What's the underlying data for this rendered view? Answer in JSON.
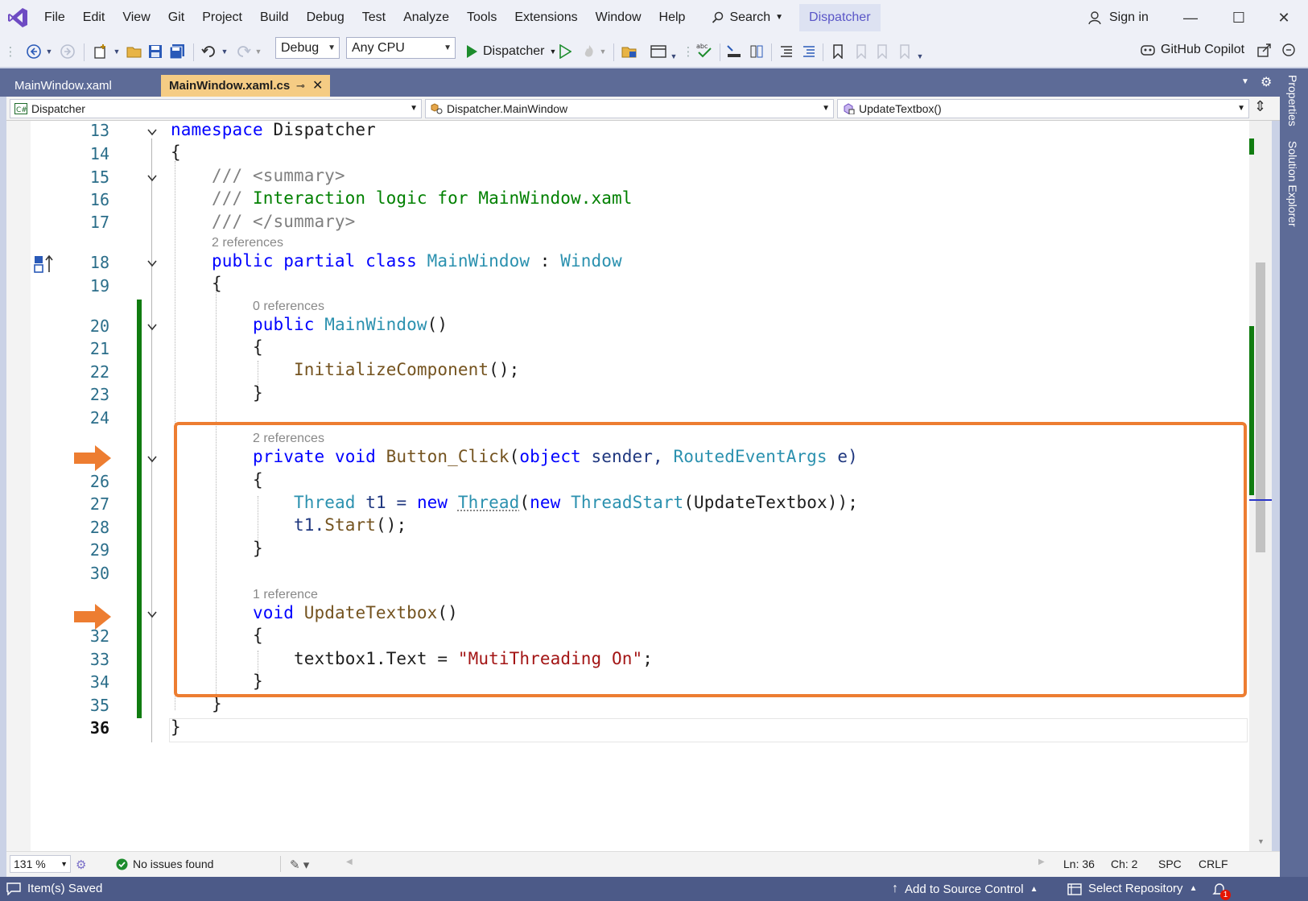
{
  "menu": [
    "File",
    "Edit",
    "View",
    "Git",
    "Project",
    "Build",
    "Debug",
    "Test",
    "Analyze",
    "Tools",
    "Extensions",
    "Window",
    "Help"
  ],
  "search_label": "Search",
  "solution_name": "Dispatcher",
  "sign_in": "Sign in",
  "toolbar": {
    "config": "Debug",
    "platform": "Any CPU",
    "run_target": "Dispatcher",
    "copilot": "GitHub Copilot"
  },
  "tabs": [
    {
      "label": "MainWindow.xaml",
      "active": false
    },
    {
      "label": "MainWindow.xaml.cs",
      "active": true
    }
  ],
  "side_tabs": [
    "Properties",
    "Solution Explorer"
  ],
  "nav": {
    "project": "Dispatcher",
    "type": "Dispatcher.MainWindow",
    "member": "UpdateTextbox()"
  },
  "line_numbers": {
    "l13": "13",
    "l14": "14",
    "l15": "15",
    "l16": "16",
    "l17": "17",
    "l18": "18",
    "l19": "19",
    "l20": "20",
    "l21": "21",
    "l22": "22",
    "l23": "23",
    "l24": "24",
    "l26": "26",
    "l27": "27",
    "l28": "28",
    "l29": "29",
    "l30": "30",
    "l32": "32",
    "l33": "33",
    "l34": "34",
    "l35": "35",
    "l36": "36"
  },
  "code": {
    "ns_kw": "namespace",
    "ns_name": " Dispatcher",
    "brace_open": "{",
    "brace_close": "}",
    "doc1_slash": "/// ",
    "doc1_tag": "<summary>",
    "doc2_slash": "/// ",
    "doc2_text": "Interaction logic for MainWindow.xaml",
    "doc3_slash": "/// ",
    "doc3_tag": "</summary>",
    "lens_class": "2 references",
    "class_kw": "public partial class",
    "class_name": "MainWindow",
    "class_colon": " : ",
    "class_base": "Window",
    "lens_ctor": "0 references",
    "ctor_kw": "public",
    "ctor_name": "MainWindow",
    "ctor_parens": "()",
    "init_call": "InitializeComponent",
    "init_tail": "();",
    "lens_click": "2 references",
    "click_kw": "private void",
    "click_name": "Button_Click",
    "click_p1": "(",
    "click_obj": "object",
    "click_sender": " sender, ",
    "click_args_type": "RoutedEventArgs",
    "click_args": " e)",
    "t1_type": "Thread",
    "t1_var": " t1 = ",
    "t1_new": "new",
    "t1_sp": " ",
    "t1_thread": "Thread",
    "t1_p": "(",
    "t1_new2": "new",
    "t1_ts": "ThreadStart",
    "t1_arg": "(UpdateTextbox));",
    "start_obj": "t1.",
    "start_call": "Start",
    "start_tail": "();",
    "lens_update": "1 reference",
    "upd_kw": "void",
    "upd_name": "UpdateTextbox",
    "upd_parens": "()",
    "tb_lhs": "textbox1.Text = ",
    "tb_str": "\"MutiThreading On\"",
    "tb_semi": ";"
  },
  "editor_status": {
    "zoom": "131 %",
    "issues": "No issues found",
    "ln": "Ln: 36",
    "ch": "Ch: 2",
    "spc": "SPC",
    "crlf": "CRLF"
  },
  "status": {
    "saved": "Item(s) Saved",
    "source_control": "Add to Source Control",
    "repository": "Select Repository",
    "notifications": "1"
  },
  "colors": {
    "accent": "#5d6b97",
    "highlight_box": "#ed7d31",
    "change_bar": "#107c10",
    "keyword": "#0000ff",
    "type": "#2b91af",
    "comment": "#008000",
    "string": "#a31515"
  }
}
